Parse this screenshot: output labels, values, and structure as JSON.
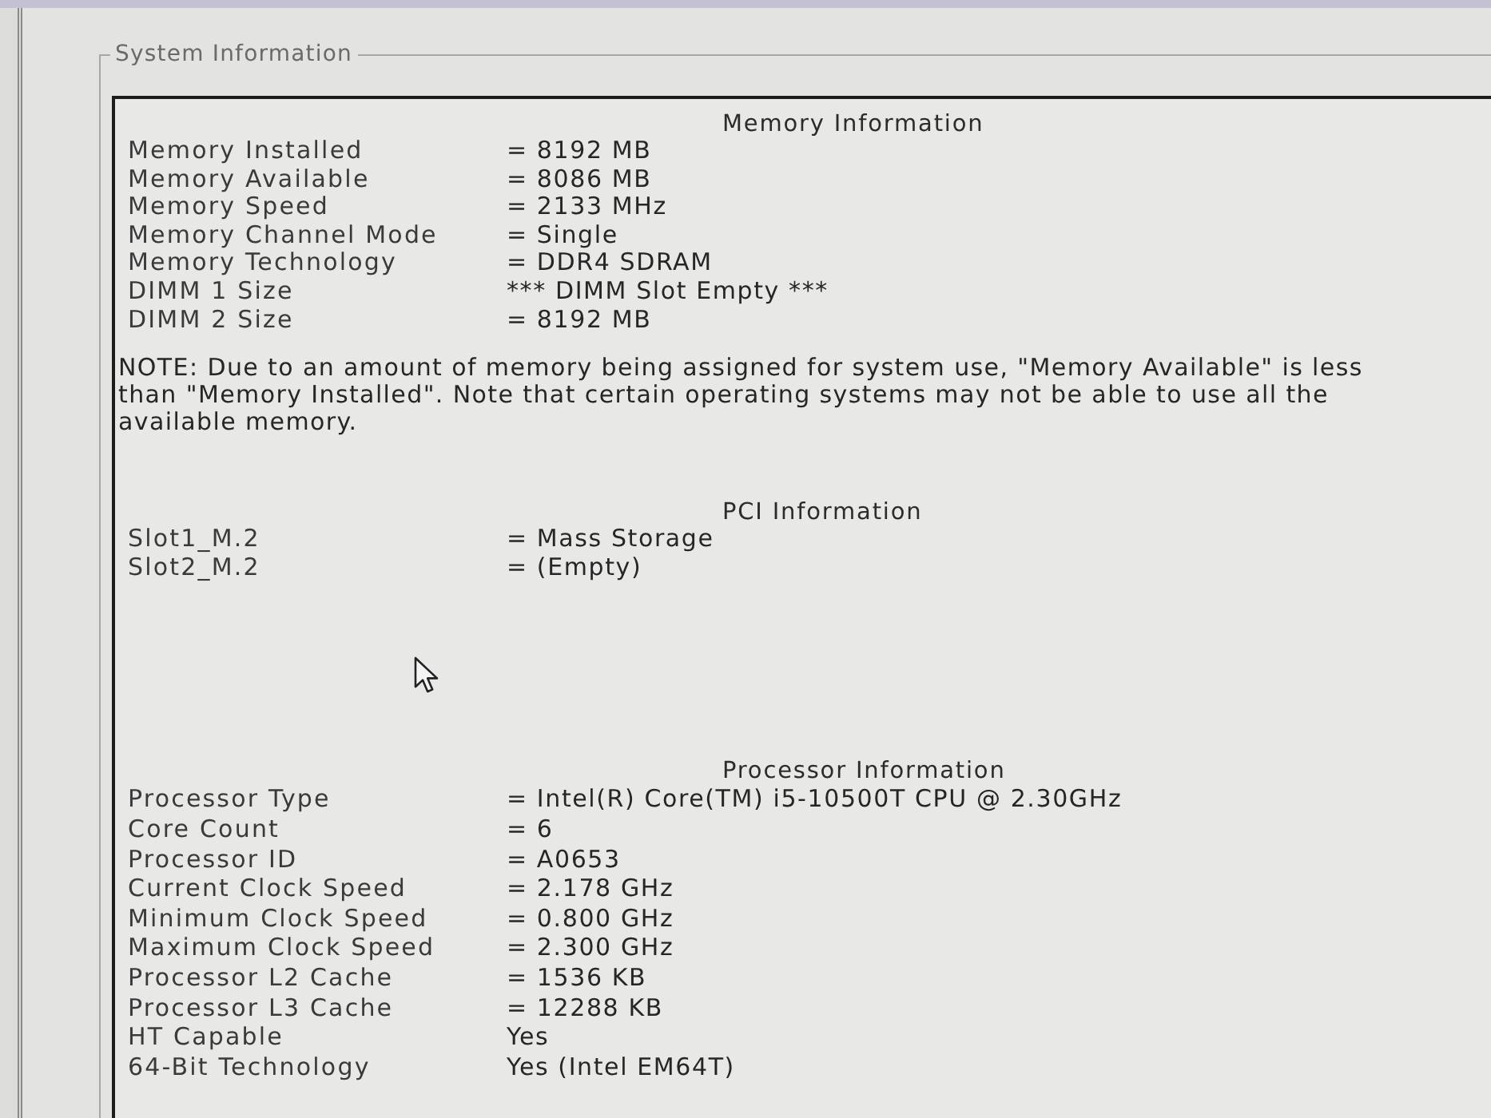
{
  "group": {
    "title": "System Information"
  },
  "sections": [
    {
      "title": "Memory Information",
      "rows": [
        {
          "label": "Memory Installed",
          "value": "= 8192 MB"
        },
        {
          "label": "Memory Available",
          "value": "= 8086 MB"
        },
        {
          "label": "Memory Speed",
          "value": "= 2133 MHz"
        },
        {
          "label": "Memory Channel Mode",
          "value": "= Single"
        },
        {
          "label": "Memory Technology",
          "value": "= DDR4 SDRAM"
        },
        {
          "label": "DIMM 1 Size",
          "value": "*** DIMM Slot Empty ***"
        },
        {
          "label": "DIMM 2 Size",
          "value": "= 8192 MB"
        }
      ],
      "note": "NOTE: Due to an amount of memory being assigned for system use, \"Memory Available\" is less than \"Memory Installed\". Note that certain operating systems may not be able to use all the available memory."
    },
    {
      "title": "PCI Information",
      "rows": [
        {
          "label": "Slot1_M.2",
          "value": "= Mass Storage"
        },
        {
          "label": "Slot2_M.2",
          "value": "= (Empty)"
        }
      ]
    },
    {
      "title": "Processor Information",
      "rows": [
        {
          "label": "Processor Type",
          "value": "= Intel(R) Core(TM) i5-10500T CPU @ 2.30GHz"
        },
        {
          "label": "Core Count",
          "value": "= 6"
        },
        {
          "label": "Processor ID",
          "value": "= A0653"
        },
        {
          "label": "Current Clock Speed",
          "value": "= 2.178 GHz"
        },
        {
          "label": "Minimum Clock Speed",
          "value": "= 0.800 GHz"
        },
        {
          "label": "Maximum Clock Speed",
          "value": "= 2.300 GHz"
        },
        {
          "label": "Processor L2 Cache",
          "value": "= 1536 KB"
        },
        {
          "label": "Processor L3 Cache",
          "value": "= 12288 KB"
        },
        {
          "label": "HT Capable",
          "value": "Yes"
        },
        {
          "label": "64-Bit Technology",
          "value": "Yes (Intel EM64T)"
        }
      ]
    }
  ]
}
